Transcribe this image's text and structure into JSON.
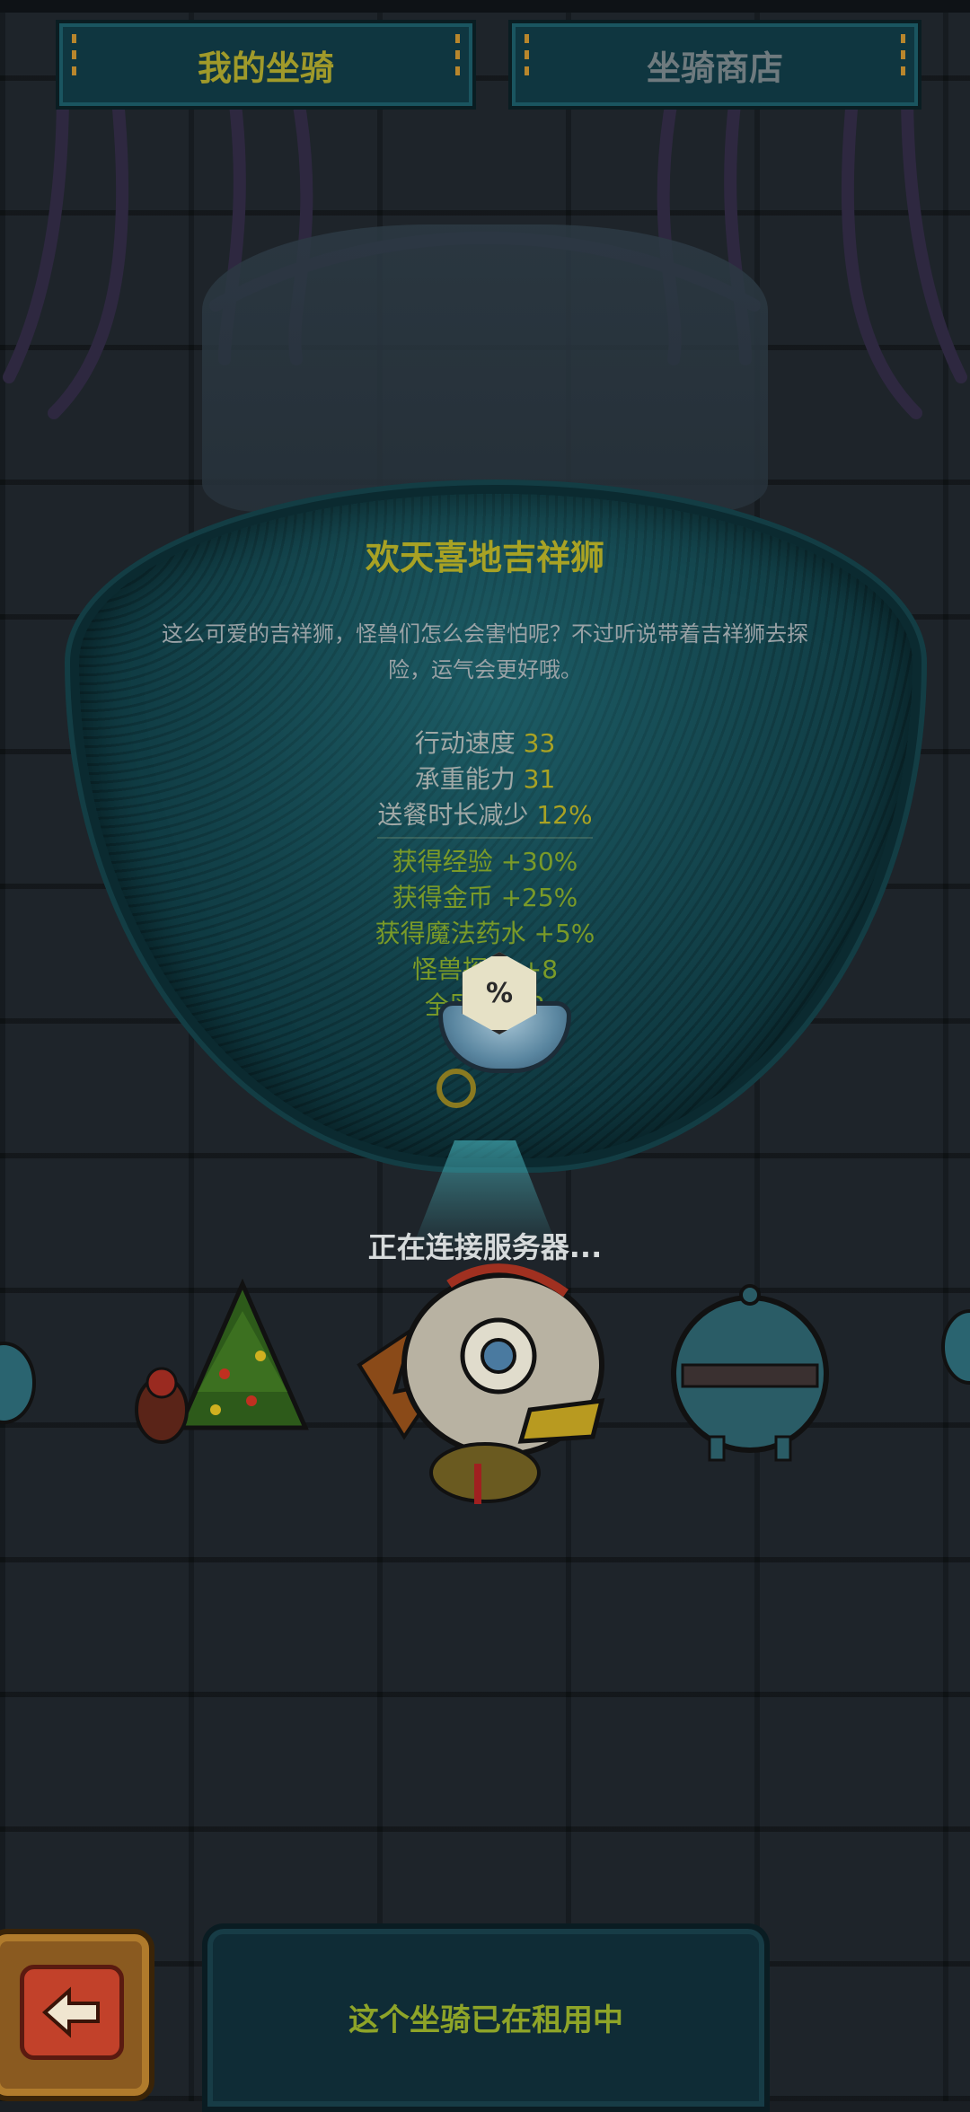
{
  "tabs": {
    "mine": "我的坐骑",
    "shop": "坐骑商店"
  },
  "mount": {
    "name": "欢天喜地吉祥狮",
    "description": "这么可爱的吉祥狮，怪兽们怎么会害怕呢？不过听说带着吉祥狮去探险，运气会更好哦。",
    "stats": [
      {
        "label": "行动速度",
        "value": "33"
      },
      {
        "label": "承重能力",
        "value": "31"
      },
      {
        "label": "送餐时长减少",
        "value": "12%"
      }
    ],
    "bonuses": [
      "获得经验 +30%",
      "获得金币 +25%",
      "获得魔法药水 +5%",
      "怪兽探索 +8",
      "全区域 +2"
    ]
  },
  "loading_text": "正在连接服务器...",
  "dice_symbol": "%",
  "status": {
    "rented_text": "这个坐骑已在租用中"
  },
  "colors": {
    "accent_gold": "#a8a224",
    "bonus_green": "#7a9a28",
    "pod_teal": "#0f3a42",
    "back_button_red": "#c2412a"
  },
  "icons": {
    "back": "back-arrow-icon",
    "dice": "dice-icon",
    "eye": "eye-icon"
  }
}
